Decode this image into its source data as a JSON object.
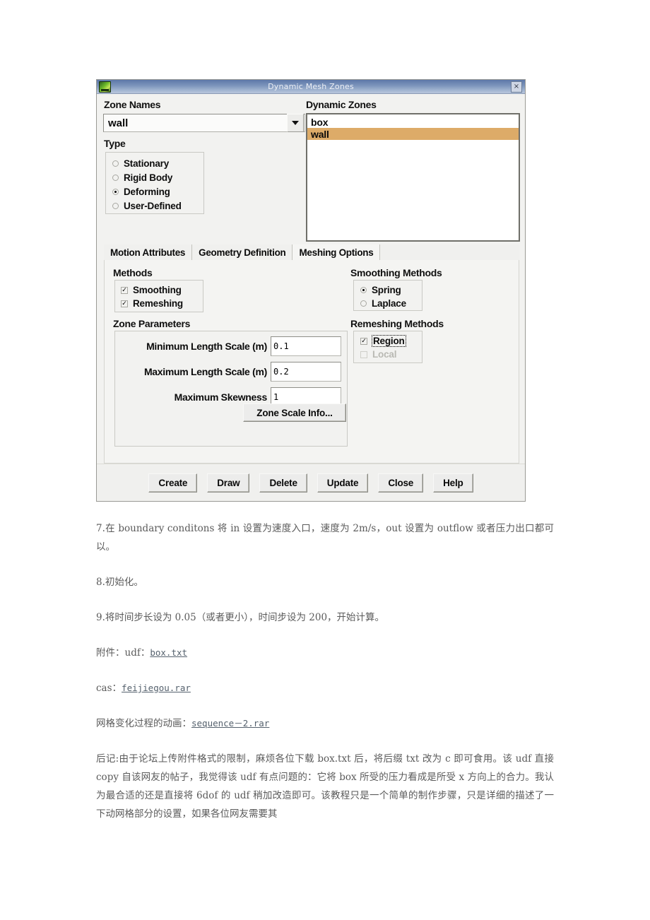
{
  "dialog": {
    "title": "Dynamic Mesh Zones",
    "icon": "fluent-app-icon",
    "close_label": "×",
    "zone_names": {
      "label": "Zone Names",
      "value": "wall",
      "dropdown_icon": "chevron-down-icon"
    },
    "type": {
      "label": "Type",
      "options": [
        {
          "label": "Stationary",
          "selected": false
        },
        {
          "label": "Rigid Body",
          "selected": false
        },
        {
          "label": "Deforming",
          "selected": true
        },
        {
          "label": "User-Defined",
          "selected": false
        }
      ]
    },
    "dynamic_zones": {
      "label": "Dynamic Zones",
      "items": [
        {
          "label": "box",
          "selected": false
        },
        {
          "label": "wall",
          "selected": true
        }
      ],
      "highlight_color": "#ddab68"
    },
    "tabs": [
      {
        "label": "Motion Attributes",
        "active": false
      },
      {
        "label": "Geometry Definition",
        "active": false
      },
      {
        "label": "Meshing Options",
        "active": true
      }
    ],
    "meshing_options": {
      "methods": {
        "label": "Methods",
        "items": [
          {
            "label": "Smoothing",
            "checked": true,
            "enabled": true
          },
          {
            "label": "Remeshing",
            "checked": true,
            "enabled": true
          }
        ]
      },
      "zone_parameters": {
        "label": "Zone Parameters",
        "fields": [
          {
            "label": "Minimum Length Scale (m)",
            "value": "0.1"
          },
          {
            "label": "Maximum Length Scale (m)",
            "value": "0.2"
          },
          {
            "label": "Maximum Skewness",
            "value": "1"
          }
        ],
        "zone_scale_info_label": "Zone Scale Info..."
      },
      "smoothing_methods": {
        "label": "Smoothing Methods",
        "options": [
          {
            "label": "Spring",
            "selected": true
          },
          {
            "label": "Laplace",
            "selected": false
          }
        ]
      },
      "remeshing_methods": {
        "label": "Remeshing Methods",
        "items": [
          {
            "label": "Region",
            "checked": true,
            "enabled": true,
            "focused": true
          },
          {
            "label": "Local",
            "checked": false,
            "enabled": false,
            "focused": false
          }
        ]
      }
    },
    "buttons": [
      {
        "label": "Create"
      },
      {
        "label": "Draw"
      },
      {
        "label": "Delete"
      },
      {
        "label": "Update"
      },
      {
        "label": "Close"
      },
      {
        "label": "Help"
      }
    ]
  },
  "article": {
    "step7": "7.在 boundary conditons 将 in 设置为速度入口，速度为 2m/s，out 设置为 outflow 或者压力出口都可以。",
    "step8": "8.初始化。",
    "step9": "9.将时间步长设为 0.05（或者更小），时间步设为 200，开始计算。",
    "attach_prefix": "附件：udf：",
    "attach_link": "box.txt",
    "cas_prefix": "cas：",
    "cas_link": "feijiegou.rar",
    "anim_prefix": "网格变化过程的动画：",
    "anim_link": "sequence－2.rar",
    "postscript": "后记:由于论坛上传附件格式的限制，麻烦各位下载 box.txt 后，将后缀 txt 改为 c 即可食用。该 udf 直接 copy 自该网友的帖子，我觉得该 udf 有点问题的：它将 box 所受的压力看成是所受 x 方向上的合力。我认为最合适的还是直接将 6dof 的 udf 稍加改造即可。该教程只是一个简单的制作步骤，只是详细的描述了一下动网格部分的设置，如果各位网友需要其"
  }
}
